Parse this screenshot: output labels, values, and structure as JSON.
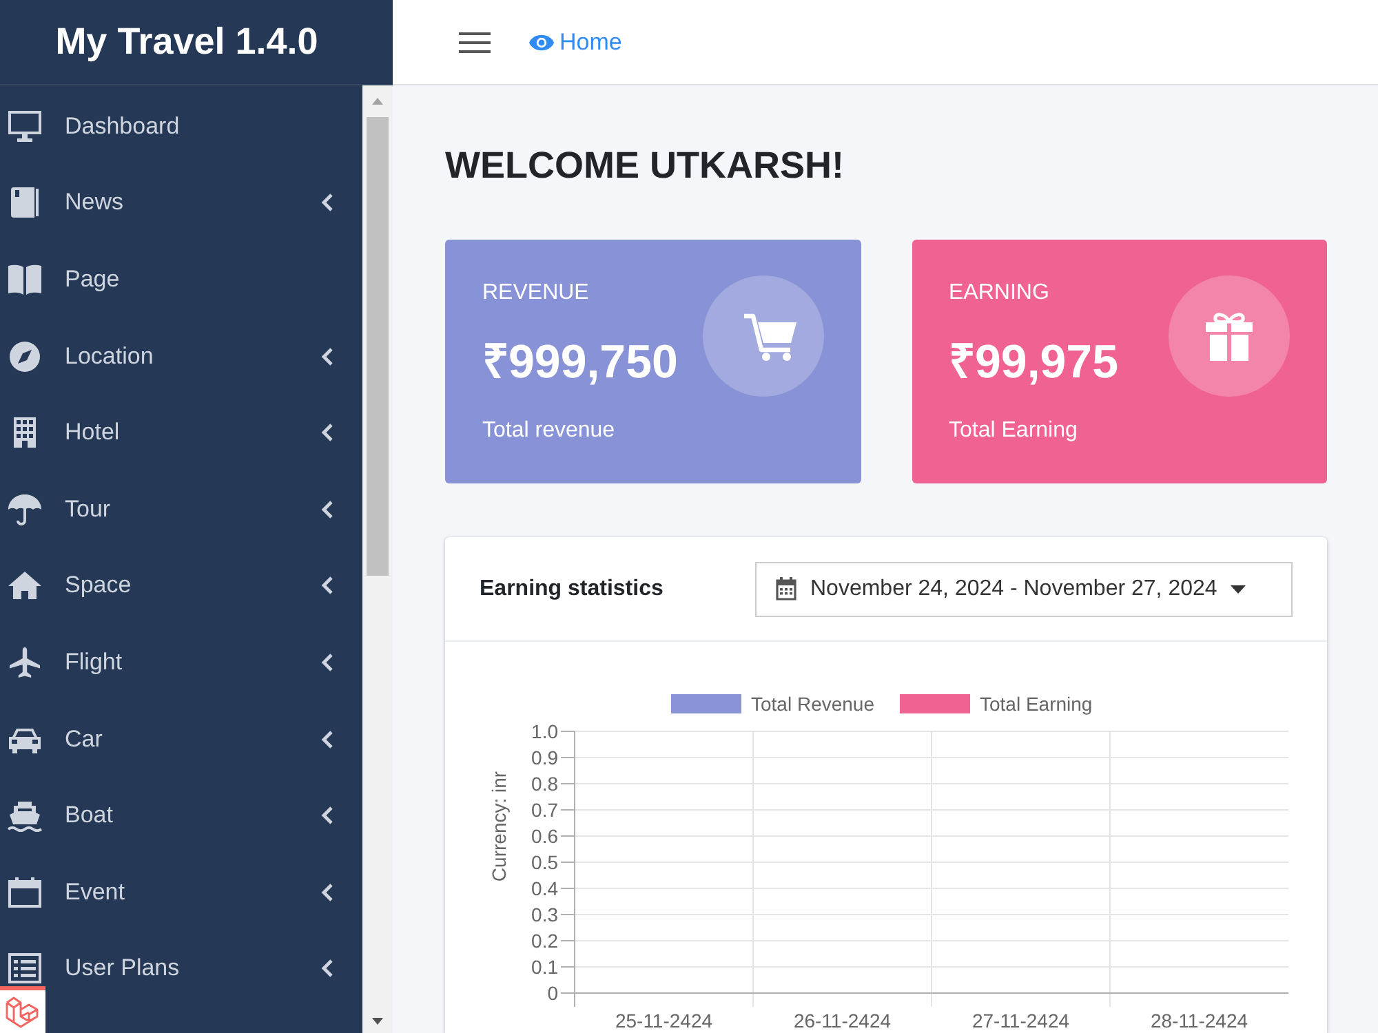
{
  "sidebar": {
    "brand": "My Travel 1.4.0",
    "items": [
      {
        "label": "Dashboard",
        "submenu": false,
        "selected": false
      },
      {
        "label": "News",
        "submenu": true,
        "selected": false
      },
      {
        "label": "Page",
        "submenu": false,
        "selected": false
      },
      {
        "label": "Location",
        "submenu": true,
        "selected": false
      },
      {
        "label": "Hotel",
        "submenu": true,
        "selected": false
      },
      {
        "label": "Tour",
        "submenu": true,
        "selected": false
      },
      {
        "label": "Space",
        "submenu": true,
        "selected": false
      },
      {
        "label": "Flight",
        "submenu": true,
        "selected": false
      },
      {
        "label": "Car",
        "submenu": true,
        "selected": false
      },
      {
        "label": "Boat",
        "submenu": true,
        "selected": false
      },
      {
        "label": "Event",
        "submenu": true,
        "selected": false
      },
      {
        "label": "User Plans",
        "submenu": true,
        "selected": false
      }
    ]
  },
  "topbar": {
    "home_link": "Home"
  },
  "page": {
    "title": "WELCOME UTKARSH!"
  },
  "stat_cards": [
    {
      "label": "REVENUE",
      "value": "₹999,750",
      "caption": "Total revenue",
      "color": "#8892d6"
    },
    {
      "label": "EARNING",
      "value": "₹99,975",
      "caption": "Total Earning",
      "color": "#f06292"
    }
  ],
  "earning_panel": {
    "title": "Earning statistics",
    "date_range": "November 24, 2024 - November 27, 2024",
    "chart_data": {
      "type": "bar",
      "ylabel": "Currency: inr",
      "categories": [
        "25-11-2424",
        "26-11-2424",
        "27-11-2424",
        "28-11-2424"
      ],
      "series": [
        {
          "name": "Total Revenue",
          "color": "#8a93d8",
          "values": [
            0,
            0,
            0,
            0
          ]
        },
        {
          "name": "Total Earning",
          "color": "#f06292",
          "values": [
            0,
            0,
            0,
            0
          ]
        }
      ],
      "ylim": [
        0,
        1
      ],
      "yticks": [
        0,
        0.1,
        0.2,
        0.3,
        0.4,
        0.5,
        0.6,
        0.7,
        0.8,
        0.9,
        {
          "value": 1,
          "label": "1.0"
        }
      ],
      "grid": true
    }
  }
}
